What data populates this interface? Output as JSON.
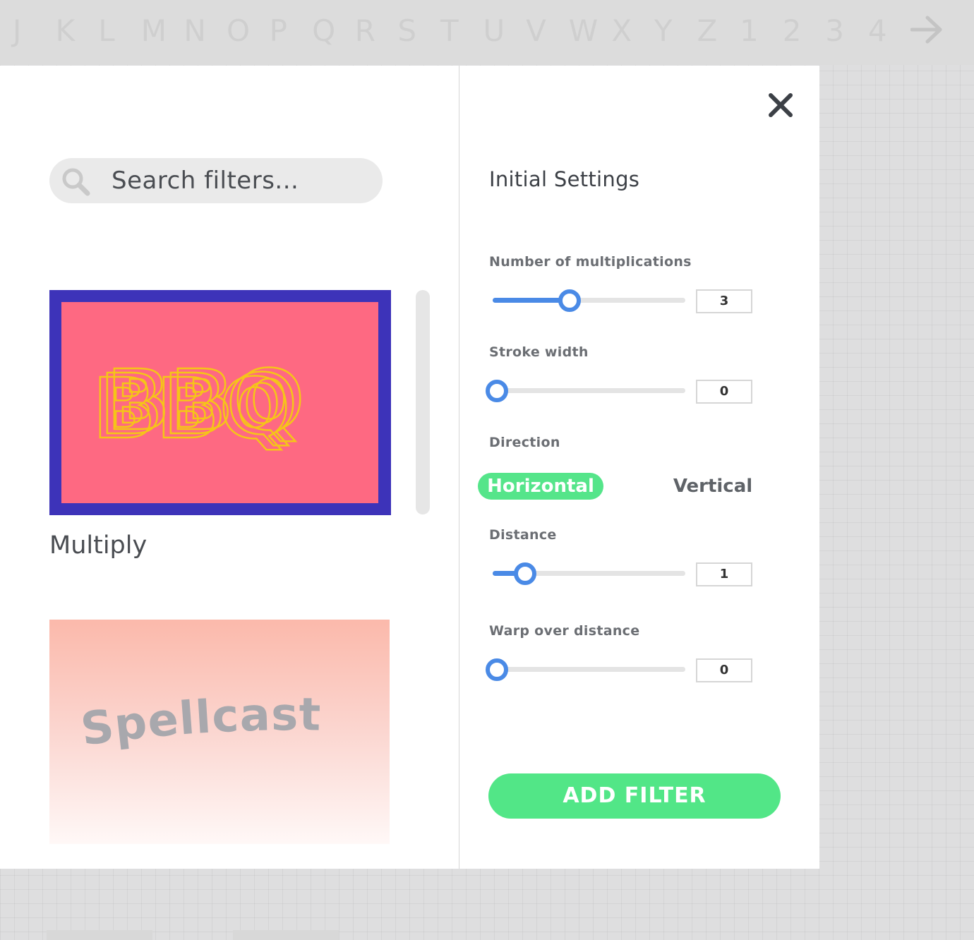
{
  "topbar": {
    "letters": [
      "J",
      "K",
      "L",
      "M",
      "N",
      "O",
      "P",
      "Q",
      "R",
      "S",
      "T",
      "U",
      "V",
      "W",
      "X",
      "Y",
      "Z",
      "1",
      "2",
      "3",
      "4"
    ]
  },
  "search": {
    "placeholder": "Search filters..."
  },
  "filters": [
    {
      "thumb_text": "BBQ",
      "label": "Multiply"
    },
    {
      "thumb_text": "Spellcast"
    }
  ],
  "settings": {
    "title": "Initial Settings",
    "fields": [
      {
        "label": "Number of multiplications",
        "value": "3",
        "fraction": 0.4
      },
      {
        "label": "Stroke width",
        "value": "0",
        "fraction": 0.0
      },
      {
        "label": "Distance",
        "value": "1",
        "fraction": 0.17
      },
      {
        "label": "Warp over distance",
        "value": "0",
        "fraction": 0.0
      }
    ],
    "direction": {
      "label": "Direction",
      "options": [
        "Horizontal",
        "Vertical"
      ],
      "selected": "Horizontal"
    },
    "add_button": "ADD FILTER"
  },
  "colors": {
    "accent_green": "#55e58a",
    "slider_blue": "#4a8ae6",
    "bbq_frame": "#3d33b9",
    "bbq_pink": "#fe6982",
    "bbq_text": "#f5c518"
  }
}
